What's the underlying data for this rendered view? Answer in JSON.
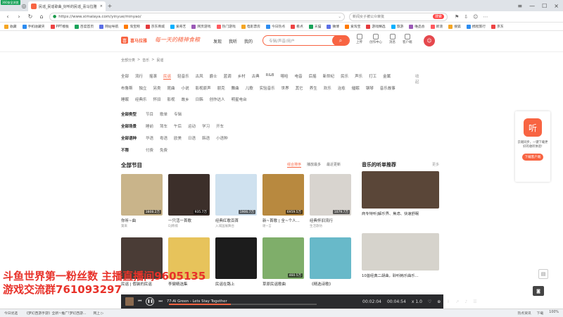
{
  "browser": {
    "badge": "360安全浏览",
    "tab_title": "民谣_民谣歌曲_好听的民谣_喜马拉雅",
    "url": "https://www.ximalaya.com/yinyue/minyao/",
    "side_search_placeholder": "新闻女子被公众审批",
    "side_search_btn": "搜索",
    "bookmarks": [
      "收藏",
      "手机收藏夹",
      "PPT模板",
      "百度首页",
      "网站导航",
      "淘宝网",
      "京东商城",
      "爱奇艺",
      "网页游戏",
      "热门游戏",
      "电影票房",
      "今日热点",
      "看点",
      "天猫",
      "微博",
      "爱淘宝",
      "游戏精选",
      "旅游",
      "唯品会",
      "新浪",
      "搜狐",
      "携程旅行",
      "京东"
    ]
  },
  "site": {
    "brand": "喜马拉雅",
    "slogan": "每一天的精神食粮",
    "nav": [
      "发现",
      "我听",
      "我的"
    ],
    "search_placeholder": "专辑/声音/用户",
    "user_icons": [
      "上传",
      "创作中心",
      "消息",
      "客户端"
    ]
  },
  "breadcrumb": [
    "全部分类",
    ">",
    "音乐",
    ">",
    "民谣"
  ],
  "categories_row1": [
    "全部",
    "流行",
    "摇滚",
    "民谣",
    "轻音乐",
    "古风",
    "爵士",
    "蓝调",
    "乡村",
    "古典",
    "R&B",
    "嘻哈",
    "电音",
    "后摇",
    "新世纪",
    "民乐",
    "声乐",
    "打工",
    "金属"
  ],
  "categories_row2": [
    "布鲁斯",
    "独立",
    "另类",
    "昆曲",
    "小说",
    "影视原声",
    "朋克",
    "舞曲",
    "儿歌",
    "实验音乐",
    "世界",
    "其它",
    "养生",
    "欢乐",
    "治愈",
    "催眠",
    "钢琴",
    "音乐故事"
  ],
  "categories_row3": [
    "睡眠",
    "经典乐",
    "怀旧",
    "影视",
    "故乡",
    "日韩",
    "创作达人",
    "明星电台"
  ],
  "more_label": "收起",
  "filters": [
    {
      "label": "全部类型",
      "options": [
        "节目",
        "歌单",
        "专辑"
      ]
    },
    {
      "label": "全部场景",
      "options": [
        "睡前",
        "驾车",
        "午后",
        "运动",
        "学习",
        "开车"
      ]
    },
    {
      "label": "全部语种",
      "options": [
        "华语",
        "粤语",
        "欧美",
        "日语",
        "韩语",
        "小语种"
      ]
    },
    {
      "label": "不限",
      "options": [
        "付费",
        "免费"
      ]
    }
  ],
  "section_title": "全部节目",
  "sort_tabs": [
    "综合排序",
    "播放最多",
    "最近更新"
  ],
  "cards": [
    {
      "title": "你听~曲",
      "author": "葉来",
      "plays": "3808.2万",
      "color": "#c9b48a"
    },
    {
      "title": "一只活一首歌",
      "author": "DJ韩楠",
      "plays": "935.7万",
      "color": "#3c2f2a"
    },
    {
      "title": "经典红歌百首",
      "author": "入城国展舞台",
      "plays": "1906.7万",
      "color": "#cfe1ef"
    },
    {
      "title": "新~首歌 | 全~个人...",
      "author": "谢~言",
      "plays": "6959.5万",
      "color": "#b8893f"
    },
    {
      "title": "经典怀旧流行",
      "author": "生活歌坊",
      "plays": "1079.7万",
      "color": "#d8d4cf"
    },
    {
      "title": "民谣 | 假装的民谣",
      "author": "",
      "plays": "",
      "color": "#4a3c36"
    },
    {
      "title": "李健精选集",
      "author": "",
      "plays": "",
      "color": "#e7c35b"
    },
    {
      "title": "民谣在路上",
      "author": "",
      "plays": "",
      "color": "#1c1c1c"
    },
    {
      "title": "草原民谣歌曲",
      "author": "",
      "plays": "460.5万",
      "color": "#7fae6a"
    },
    {
      "title": "《精选诗歌》",
      "author": "",
      "plays": "",
      "color": "#68b9c9"
    }
  ],
  "recommend": {
    "title": "音乐的听单推荐",
    "more": "更多",
    "items": [
      {
        "title": "商专特听|解乐界、焦虑、快速舒眠",
        "color": "#5a4638"
      },
      {
        "title": "10首经典二胡曲，聆听韩乐曲乐...",
        "color": "#d6d3cc"
      }
    ]
  },
  "promo": {
    "title": "云端同步，一键下载更好的收听体验!",
    "btn": "下载客户端"
  },
  "overlay": {
    "line1": "斗鱼世界第一粉丝数 主播直播间9605135",
    "line2": "游戏交流群761093297"
  },
  "player": {
    "song": "77-Al Green - Lets Stay Together",
    "current_time": "00:02:04",
    "total_time": "00:04:54",
    "progress": 0.42,
    "speed": "x 1.0"
  },
  "statusbar": {
    "items": [
      "今日优选",
      "《梦幻西游手游》全新~推广!梦幻西游...",
      "网上 ▷ "
    ],
    "right": [
      "热点资讯",
      "下载",
      "100%"
    ]
  }
}
